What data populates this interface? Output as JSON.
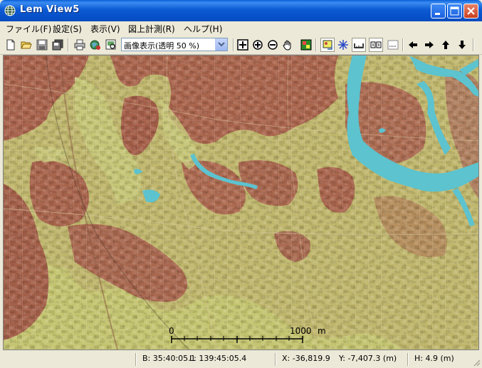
{
  "window": {
    "title": "Lem View5"
  },
  "menu": [
    "ファイル(F)",
    "設定(S)",
    "表示(V)",
    "図上計測(R)",
    "ヘルプ(H)"
  ],
  "toolbar": {
    "display_mode": "画像表示(透明 50 %)",
    "buttons": [
      "new-icon",
      "open-icon",
      "save-icon",
      "save-as-icon",
      "print-icon",
      "web-icon",
      "preview-icon",
      "zoom-all-icon",
      "zoom-in-icon",
      "zoom-out-icon",
      "pan-hand-icon",
      "layer-icon",
      "image-toggle-icon",
      "grid-icon",
      "distance-icon",
      "area-icon",
      "contour-icon",
      "arrow-left-icon",
      "arrow-right-icon",
      "arrow-up-icon",
      "arrow-down-icon"
    ]
  },
  "map": {
    "scale_start": "0",
    "scale_end": "1000",
    "scale_unit": "m"
  },
  "status": {
    "lat": "B: 35:40:05.1",
    "lon": "L: 139:45:05.4",
    "x": "X: -36,819.9",
    "y": "Y: -7,407.3 (m)",
    "h": "H:   4.9 (m)"
  },
  "colors": {
    "titlebar": "#0650c8",
    "chrome": "#ece9d8",
    "terrain_low": "#c2c66e",
    "terrain_high": "#a8624a",
    "water": "#5cc3cf"
  }
}
